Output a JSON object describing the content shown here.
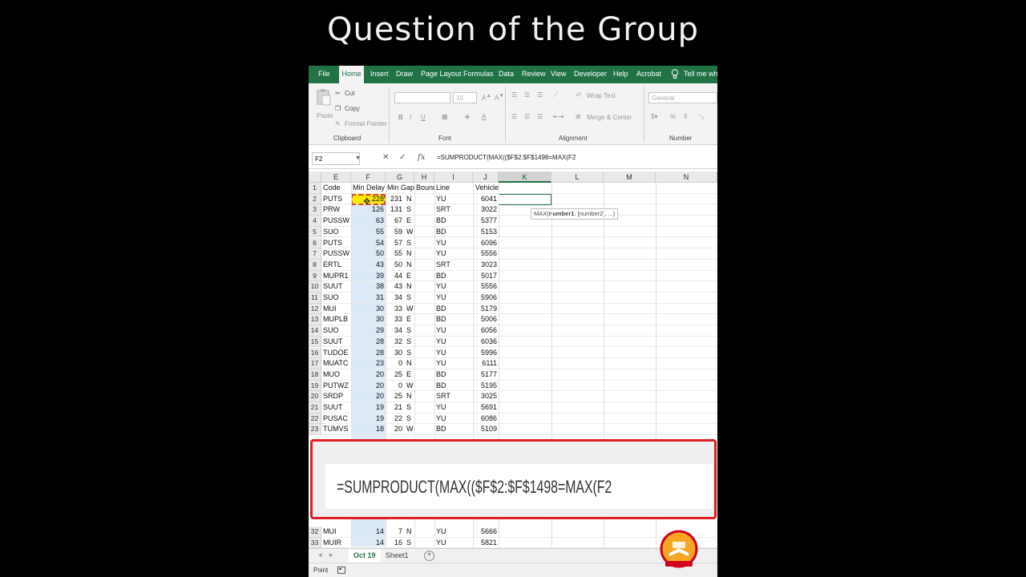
{
  "banner": {
    "title": "Question of the Group"
  },
  "ribbon": {
    "tabs": [
      "File",
      "Home",
      "Insert",
      "Draw",
      "Page Layout",
      "Formulas",
      "Data",
      "Review",
      "View",
      "Developer",
      "Help",
      "Acrobat",
      "Tell me what"
    ],
    "active_tab": "Home",
    "clipboard": {
      "paste": "Paste",
      "cut": "Cut",
      "copy": "Copy",
      "format_painter": "Format Painter",
      "label": "Clipboard"
    },
    "font": {
      "size": "10",
      "bold": "B",
      "italic": "I",
      "underline": "U",
      "label": "Font"
    },
    "alignment": {
      "wrap": "Wrap Text",
      "merge": "Merge & Center",
      "label": "Alignment"
    },
    "number": {
      "format": "General",
      "label": "Number"
    }
  },
  "formula_bar": {
    "name_box": "F2",
    "fx": "fx",
    "formula": "=SUMPRODUCT(MAX(($F$2:$F$1498=MAX(F2"
  },
  "grid": {
    "columns": [
      "E",
      "F",
      "G",
      "H",
      "I",
      "J",
      "K",
      "L",
      "M",
      "N"
    ],
    "selected_column": "K",
    "header_row": [
      "Code",
      "Min Delay",
      "Min Gap",
      "Bound",
      "Line",
      "Vehicle"
    ],
    "rows": [
      {
        "n": "2",
        "c": [
          "PUTS",
          "228",
          "231",
          "N",
          "YU",
          "6041"
        ]
      },
      {
        "n": "3",
        "c": [
          "PRW",
          "126",
          "131",
          "S",
          "SRT",
          "3022"
        ]
      },
      {
        "n": "4",
        "c": [
          "PUSSW",
          "63",
          "67",
          "E",
          "BD",
          "5377"
        ]
      },
      {
        "n": "5",
        "c": [
          "SUO",
          "55",
          "59",
          "W",
          "BD",
          "5153"
        ]
      },
      {
        "n": "6",
        "c": [
          "PUTS",
          "54",
          "57",
          "S",
          "YU",
          "6096"
        ]
      },
      {
        "n": "7",
        "c": [
          "PUSSW",
          "50",
          "55",
          "N",
          "YU",
          "5556"
        ]
      },
      {
        "n": "8",
        "c": [
          "ERTL",
          "43",
          "50",
          "N",
          "SRT",
          "3023"
        ]
      },
      {
        "n": "9",
        "c": [
          "MUPR1",
          "39",
          "44",
          "E",
          "BD",
          "5017"
        ]
      },
      {
        "n": "10",
        "c": [
          "SUUT",
          "38",
          "43",
          "N",
          "YU",
          "5556"
        ]
      },
      {
        "n": "11",
        "c": [
          "SUO",
          "31",
          "34",
          "S",
          "YU",
          "5906"
        ]
      },
      {
        "n": "12",
        "c": [
          "MUI",
          "30",
          "33",
          "W",
          "BD",
          "5179"
        ]
      },
      {
        "n": "13",
        "c": [
          "MUPLB",
          "30",
          "33",
          "E",
          "BD",
          "5006"
        ]
      },
      {
        "n": "14",
        "c": [
          "SUO",
          "29",
          "34",
          "S",
          "YU",
          "6056"
        ]
      },
      {
        "n": "15",
        "c": [
          "SUUT",
          "28",
          "32",
          "S",
          "YU",
          "6036"
        ]
      },
      {
        "n": "16",
        "c": [
          "TUDOE",
          "28",
          "30",
          "S",
          "YU",
          "5996"
        ]
      },
      {
        "n": "17",
        "c": [
          "MUATC",
          "23",
          "0",
          "N",
          "YU",
          "6111"
        ]
      },
      {
        "n": "18",
        "c": [
          "MUO",
          "20",
          "25",
          "E",
          "BD",
          "5177"
        ]
      },
      {
        "n": "19",
        "c": [
          "PUTWZ",
          "20",
          "0",
          "W",
          "BD",
          "5195"
        ]
      },
      {
        "n": "20",
        "c": [
          "SRDP",
          "20",
          "25",
          "N",
          "SRT",
          "3025"
        ]
      },
      {
        "n": "21",
        "c": [
          "SUUT",
          "19",
          "21",
          "S",
          "YU",
          "5691"
        ]
      },
      {
        "n": "22",
        "c": [
          "PUSAC",
          "19",
          "22",
          "S",
          "YU",
          "6086"
        ]
      },
      {
        "n": "23",
        "c": [
          "TUMVS",
          "18",
          "20",
          "W",
          "BD",
          "5109"
        ]
      }
    ],
    "bottom_rows": [
      {
        "n": "32",
        "c": [
          "MUI",
          "14",
          "7",
          "N",
          "YU",
          "5666"
        ]
      },
      {
        "n": "33",
        "c": [
          "MUIR",
          "14",
          "16",
          "S",
          "YU",
          "5821"
        ]
      }
    ],
    "tooltip": {
      "fn": "MAX(",
      "arg": "number1",
      "rest": ", [number2], ...)"
    }
  },
  "zoom_overlay": {
    "formula": "=SUMPRODUCT(MAX(($F$2:$F$1498=MAX(F2"
  },
  "sheets": {
    "tabs": [
      "Oct 19",
      "Sheet1"
    ],
    "active": "Oct 19",
    "add": "+"
  },
  "status": {
    "mode": "Point"
  },
  "colors": {
    "excel_green": "#217346",
    "highlight_red": "#e01e26",
    "cell_yellow": "#ffe900"
  }
}
